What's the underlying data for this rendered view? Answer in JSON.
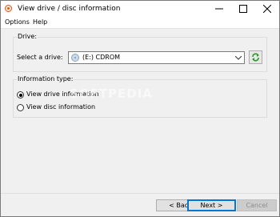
{
  "window": {
    "title": "View drive / disc information"
  },
  "menu": {
    "items": [
      "Options",
      "Help"
    ]
  },
  "drive_group": {
    "title": "Drive:",
    "select_label": "Select a drive:",
    "selected_drive": "(E:) CDROM"
  },
  "info_group": {
    "title": "Information type:",
    "options": [
      {
        "label": "View drive information",
        "checked": true
      },
      {
        "label": "View disc information",
        "checked": false
      }
    ]
  },
  "watermark": "SOFTPEDIA",
  "buttons": {
    "back": "< Back",
    "next": "Next >",
    "cancel": "Cancel"
  },
  "colors": {
    "accent": "#0078d7",
    "refresh": "#2e9a2e",
    "app_icon": "#d65a1f"
  }
}
